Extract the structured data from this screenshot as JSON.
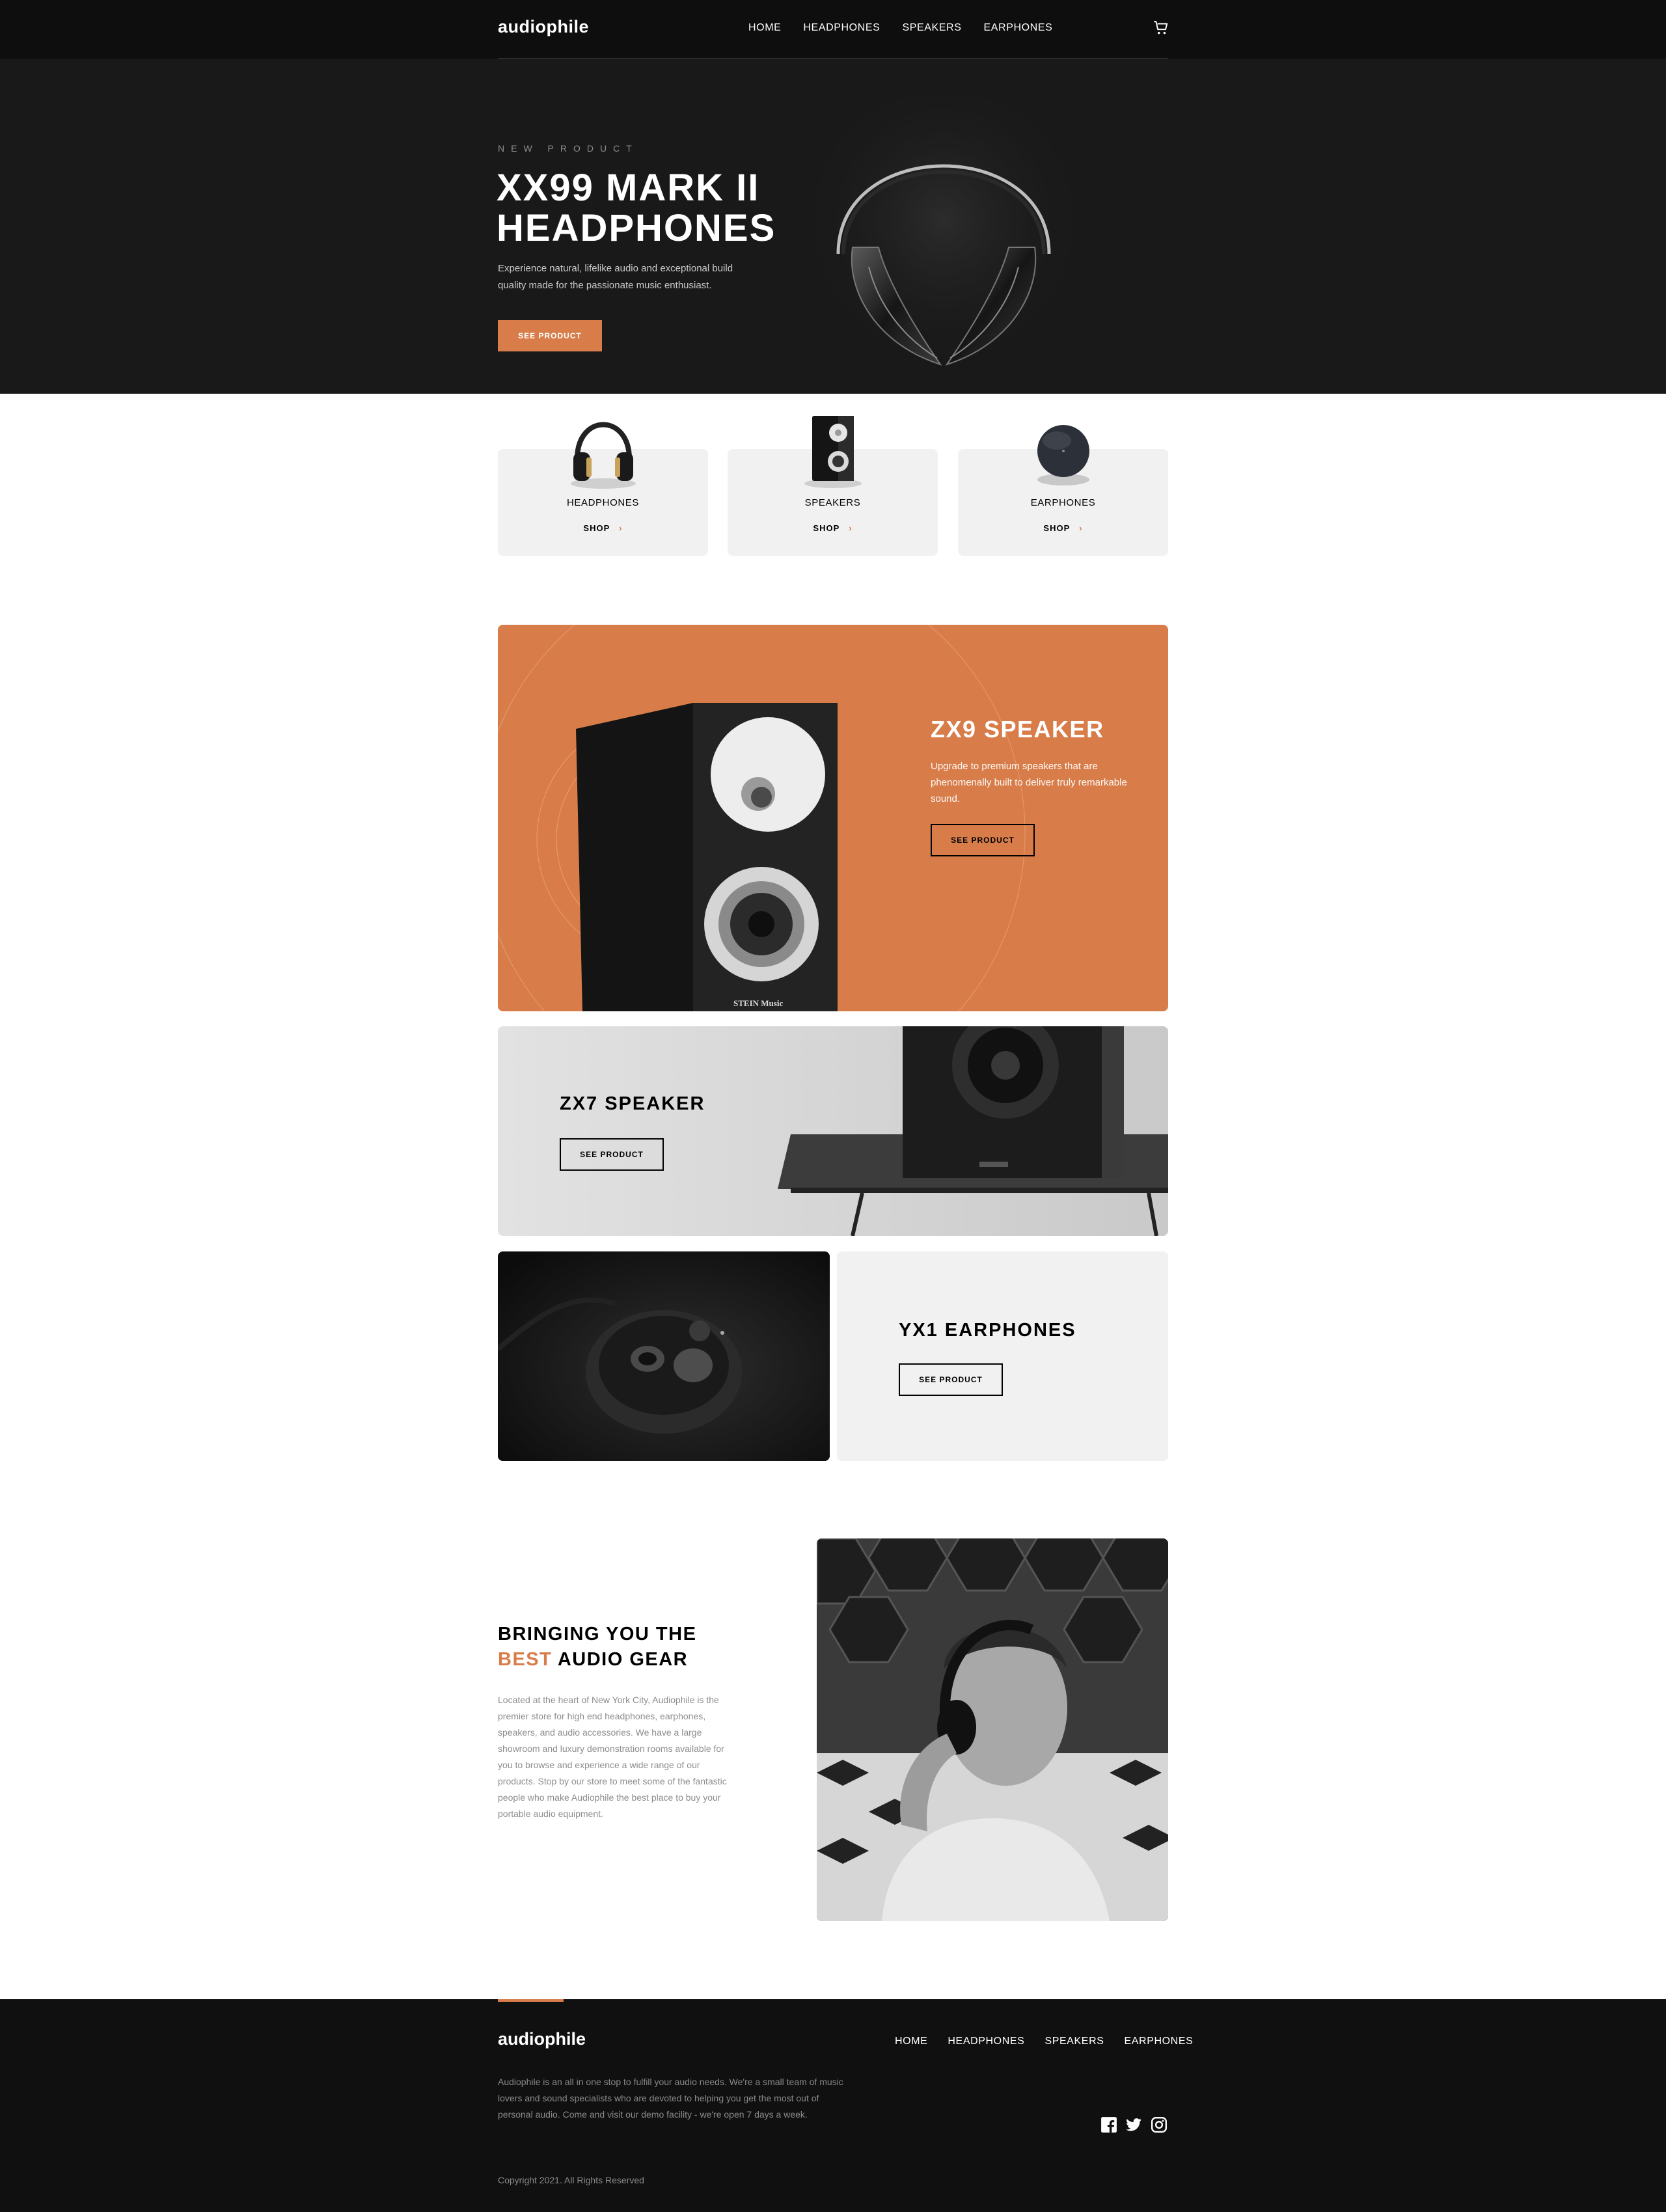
{
  "brand": {
    "logo": "audiophile",
    "accent": "#d87d4a"
  },
  "nav": {
    "items": [
      "HOME",
      "HEADPHONES",
      "SPEAKERS",
      "EARPHONES"
    ],
    "cart_icon": "cart-icon"
  },
  "hero": {
    "overline": "NEW PRODUCT",
    "title": "XX99 MARK II HEADPHONES",
    "description": "Experience natural, lifelike audio and exceptional build quality made for the passionate music enthusiast.",
    "button": "SEE PRODUCT"
  },
  "categories": [
    {
      "label": "HEADPHONES",
      "shop": "SHOP"
    },
    {
      "label": "SPEAKERS",
      "shop": "SHOP"
    },
    {
      "label": "EARPHONES",
      "shop": "SHOP"
    }
  ],
  "zx9": {
    "title": "ZX9 SPEAKER",
    "description": "Upgrade to premium speakers that are phenomenally built to deliver truly remarkable sound.",
    "button": "SEE PRODUCT",
    "brand_mark": "STEIN Music"
  },
  "zx7": {
    "title": "ZX7 SPEAKER",
    "button": "SEE PRODUCT"
  },
  "yx1": {
    "title": "YX1 EARPHONES",
    "button": "SEE PRODUCT"
  },
  "about": {
    "title_line1": "BRINGING YOU THE",
    "title_accent": "BEST",
    "title_rest": "AUDIO GEAR",
    "description": "Located at the heart of New York City, Audiophile is the premier store for high end headphones, earphones, speakers, and audio accessories. We have a large showroom and luxury demonstration rooms available for you to browse and experience a wide range of our products. Stop by our store to meet some of the fantastic people who make Audiophile the best place to buy your portable audio equipment."
  },
  "footer": {
    "logo": "audiophile",
    "nav": [
      "HOME",
      "HEADPHONES",
      "SPEAKERS",
      "EARPHONES"
    ],
    "description": "Audiophile is an all in one stop to fulfill your audio needs. We're a small team of music lovers and sound specialists who are devoted to helping you get the most out of personal audio. Come and visit our demo facility - we're open 7 days a week.",
    "copyright": "Copyright 2021. All Rights Reserved",
    "social": [
      "facebook-icon",
      "twitter-icon",
      "instagram-icon"
    ]
  }
}
